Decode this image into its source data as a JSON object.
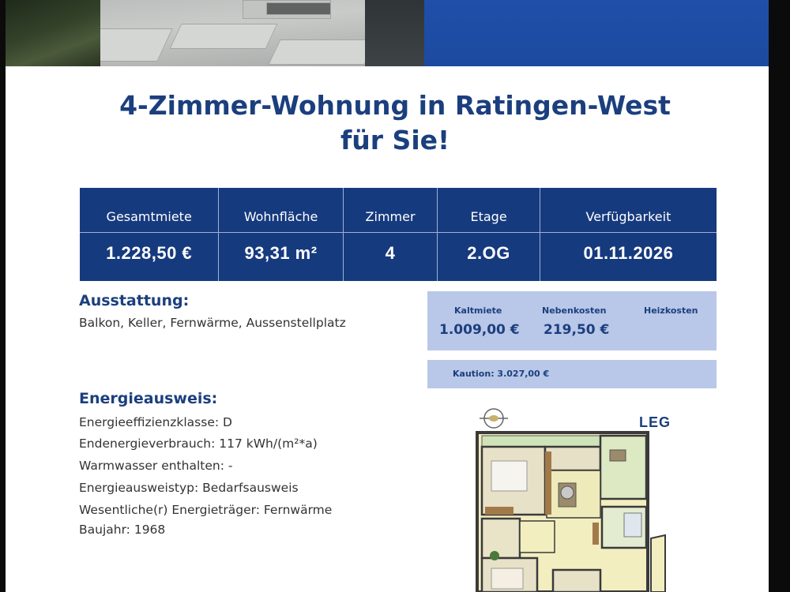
{
  "listing": {
    "title_line1": "4-Zimmer-Wohnung in Ratingen-West",
    "title_line2": "für Sie!"
  },
  "facts": [
    {
      "label": "Gesamtmiete",
      "value": "1.228,50 €"
    },
    {
      "label": "Wohnfläche",
      "value": "93,31 m²"
    },
    {
      "label": "Zimmer",
      "value": "4"
    },
    {
      "label": "Etage",
      "value": "2.OG"
    },
    {
      "label": "Verfügbarkeit",
      "value": "01.11.2026"
    }
  ],
  "ausstattung": {
    "heading": "Ausstattung:",
    "text": "Balkon, Keller, Fernwärme, Aussenstellplatz"
  },
  "costs": {
    "kaltmiete_label": "Kaltmiete",
    "kaltmiete_value": "1.009,00 €",
    "nebenkosten_label": "Nebenkosten",
    "nebenkosten_value": "219,50 €",
    "heizkosten_label": "Heizkosten",
    "kaution": "Kaution: 3.027,00 €"
  },
  "energie": {
    "heading": "Energieausweis:",
    "lines": [
      "Energieeffizienzklasse: D",
      "Endenergieverbrauch: 117 kWh/(m²*a)",
      "Warmwasser enthalten: -",
      "Energieausweistyp: Bedarfsausweis",
      "Wesentliche(r) Energieträger: Fernwärme",
      "Baujahr: 1968"
    ]
  },
  "brand": {
    "logo": "LEG",
    "color": "#1b3f7e"
  },
  "colors": {
    "table_bg": "#163a7e",
    "cost_bg": "#b9c7e8",
    "heading": "#1b3f7e"
  },
  "icons": [
    "compass-icon"
  ]
}
